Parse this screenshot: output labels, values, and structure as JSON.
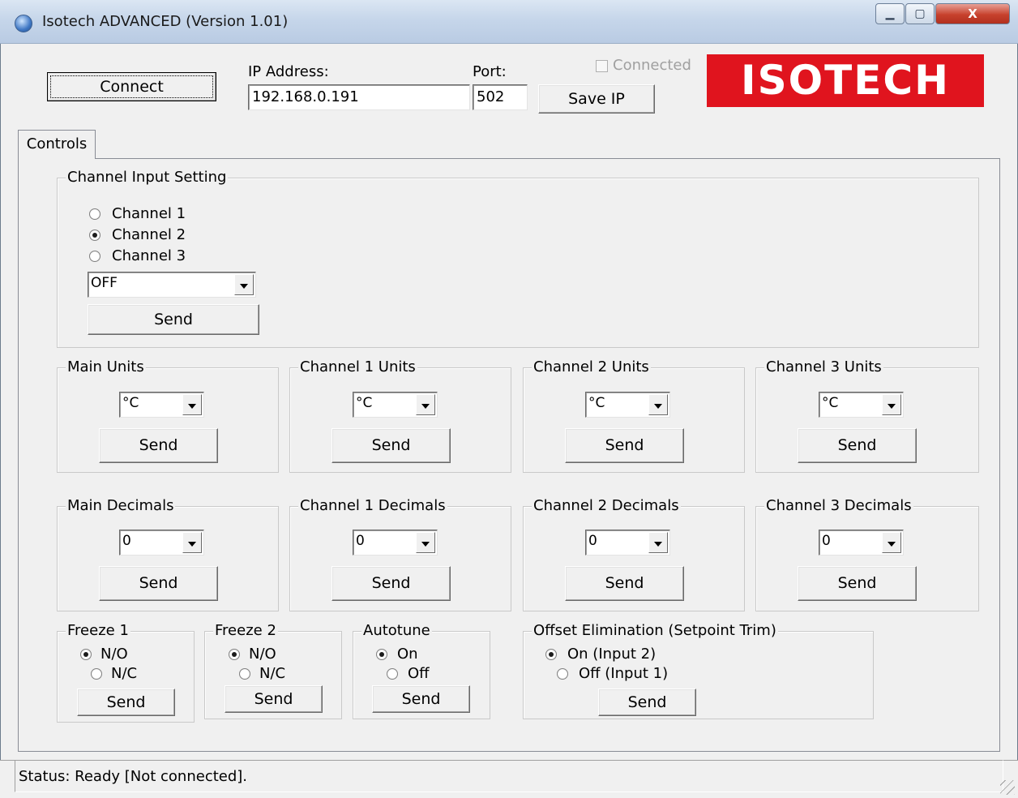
{
  "window": {
    "title": "Isotech ADVANCED (Version 1.01)",
    "minimize": "▁",
    "maximize": "▢",
    "close": "X"
  },
  "connection": {
    "connect_label": "Connect",
    "ip_label": "IP Address:",
    "ip_value": "192.168.0.191",
    "port_label": "Port:",
    "port_value": "502",
    "save_label": "Save IP",
    "connected_label": "Connected",
    "logo_text": "ISOTECH"
  },
  "tabs": [
    {
      "label": "Controls"
    }
  ],
  "channel_input": {
    "title": "Channel Input Setting",
    "options": [
      "Channel 1",
      "Channel 2",
      "Channel 3"
    ],
    "selected": "Channel 2",
    "combo_value": "OFF",
    "send_label": "Send"
  },
  "units": [
    {
      "title": "Main Units",
      "value": "°C",
      "send": "Send"
    },
    {
      "title": "Channel 1 Units",
      "value": "°C",
      "send": "Send"
    },
    {
      "title": "Channel 2 Units",
      "value": "°C",
      "send": "Send"
    },
    {
      "title": "Channel 3 Units",
      "value": "°C",
      "send": "Send"
    }
  ],
  "decimals": [
    {
      "title": "Main Decimals",
      "value": "0",
      "send": "Send"
    },
    {
      "title": "Channel 1 Decimals",
      "value": "0",
      "send": "Send"
    },
    {
      "title": "Channel 2 Decimals",
      "value": "0",
      "send": "Send"
    },
    {
      "title": "Channel 3 Decimals",
      "value": "0",
      "send": "Send"
    }
  ],
  "freeze1": {
    "title": "Freeze 1",
    "opt1": "N/O",
    "opt2": "N/C",
    "selected": "N/O",
    "send": "Send"
  },
  "freeze2": {
    "title": "Freeze 2",
    "opt1": "N/O",
    "opt2": "N/C",
    "selected": "N/O",
    "send": "Send"
  },
  "autotune": {
    "title": "Autotune",
    "opt1": "On",
    "opt2": "Off",
    "selected": "On",
    "send": "Send"
  },
  "offset": {
    "title": "Offset Elimination (Setpoint Trim)",
    "opt1": "On (Input 2)",
    "opt2": "Off (Input 1)",
    "selected": "On (Input 2)",
    "send": "Send"
  },
  "status": {
    "text": "Status: Ready [Not connected]."
  },
  "colors": {
    "logo_bg": "#e0141e",
    "window_bg": "#f0f0f0"
  }
}
